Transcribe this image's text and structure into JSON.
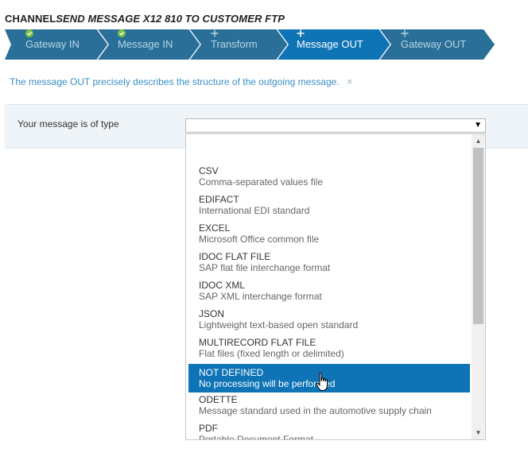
{
  "page": {
    "title_plain": "CHANNEL",
    "title_italic": "SEND MESSAGE X12 810 TO CUSTOMER FTP"
  },
  "wizard": {
    "steps": [
      {
        "label": "Gateway IN",
        "icon": "check-icon",
        "state": "done"
      },
      {
        "label": "Message IN",
        "icon": "check-icon",
        "state": "done"
      },
      {
        "label": "Transform",
        "icon": "plus-icon",
        "state": "pending"
      },
      {
        "label": "Message OUT",
        "icon": "plus-icon",
        "state": "active"
      },
      {
        "label": "Gateway OUT",
        "icon": "plus-icon",
        "state": "pending"
      }
    ]
  },
  "info": {
    "text": "The message OUT precisely describes the structure of the outgoing message.",
    "close": "×"
  },
  "form": {
    "label": "Your message is of type",
    "select_value": "",
    "arrow": "▼"
  },
  "dropdown": {
    "options": [
      {
        "name": "CSV",
        "desc": "Comma-separated values file"
      },
      {
        "name": "EDIFACT",
        "desc": "International EDI standard"
      },
      {
        "name": "EXCEL",
        "desc": "Microsoft Office common file"
      },
      {
        "name": "IDOC FLAT FILE",
        "desc": "SAP flat file interchange format"
      },
      {
        "name": "IDOC XML",
        "desc": "SAP XML interchange format"
      },
      {
        "name": "JSON",
        "desc": "Lightweight text-based open standard"
      },
      {
        "name": "MULTIRECORD FLAT FILE",
        "desc": "Flat files (fixed length or delimited)"
      },
      {
        "name": "NOT DEFINED",
        "desc": "No processing will be performed"
      },
      {
        "name": "ODETTE",
        "desc": "Message standard used in the automotive supply chain"
      },
      {
        "name": "PDF",
        "desc": "Portable Document Format"
      }
    ],
    "highlighted": "NOT DEFINED",
    "scroll_up": "▲",
    "scroll_down": "▼"
  },
  "colors": {
    "step_done": "#2a6f98",
    "step_active": "#0f74b6",
    "info_text": "#3a8fc4",
    "highlight": "#0f74b6"
  }
}
